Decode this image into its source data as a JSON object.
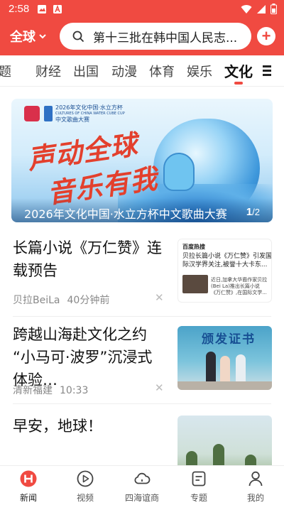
{
  "status_bar": {
    "time": "2:58"
  },
  "header": {
    "region_label": "全球",
    "search_text": "第十三批在韩中国人民志...",
    "plus_label": "+"
  },
  "tabs": [
    "题",
    "财经",
    "出国",
    "动漫",
    "体育",
    "娱乐",
    "文化"
  ],
  "active_tab": "文化",
  "banner": {
    "org_line1": "2026年文化中国·水立方杯",
    "org_line2": "CULTURES OF CHINA WATER CUBE CUP",
    "org_line3": "中文歌曲大赛",
    "slogan_line1": "声动全球",
    "slogan_line2": "音乐有我",
    "caption": "2026年文化中国·水立方杯中文歌曲大赛",
    "page_current": "1",
    "page_total": "/2"
  },
  "news": [
    {
      "title": "长篇小说《万仁赞》连载预告",
      "source": "贝拉BeiLa",
      "time": "40分钟前",
      "thumb": {
        "brand": "百度热搜",
        "line1": "贝拉长篇小说《万仁赞》引发国",
        "line2": "际汉学界关注,被誉十大卡东...",
        "small1": "近日,加拿大华裔作家贝拉",
        "small2": "(Bei La)推出长篇小说",
        "small3": "《万仁赞》,在国际文学..."
      }
    },
    {
      "title": "跨越山海赴文化之约 “小马可·波罗”沉浸式体验…",
      "source": "清新福建",
      "time": "10:33",
      "thumb": {
        "banner_text": "颁发证书"
      }
    },
    {
      "title": "早安，地球！",
      "source": "",
      "time": "",
      "thumb": {}
    }
  ],
  "bottom_nav": [
    {
      "label": "新闻",
      "icon": "news-home-icon"
    },
    {
      "label": "视频",
      "icon": "play-icon"
    },
    {
      "label": "四海谊商",
      "icon": "cloud-icon"
    },
    {
      "label": "专题",
      "icon": "topic-list-icon"
    },
    {
      "label": "我的",
      "icon": "profile-icon"
    }
  ],
  "colors": {
    "brand": "#f04a41",
    "text": "#111111",
    "meta": "#888888"
  }
}
